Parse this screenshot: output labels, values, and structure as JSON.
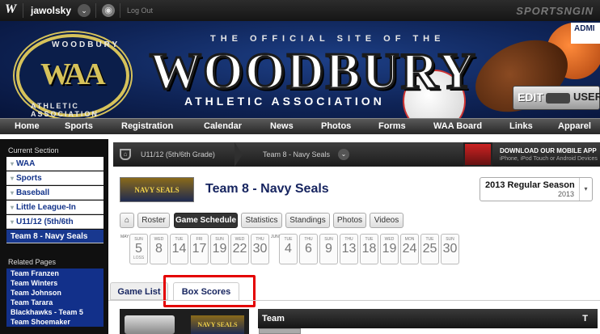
{
  "topbar": {
    "logo_letter": "W",
    "username": "jawolsky",
    "user_menu_icon": "⌄",
    "globe_icon": "◉",
    "logout_label": "Log Out",
    "brand": "SPORTSNGIN"
  },
  "banner": {
    "official": "THE OFFICIAL SITE OF THE",
    "title": "WOODBURY",
    "subtitle": "ATHLETIC ASSOCIATION",
    "logo_text_top": "WOODBURY",
    "logo_mark": "WAA",
    "logo_text_bottom": "ATHLETIC ASSOCIATION",
    "admin_label": "ADMI",
    "edit_label": "EDIT",
    "user_label": "USER"
  },
  "nav": {
    "items": [
      "Home",
      "Sports",
      "Registration",
      "Calendar",
      "News",
      "Photos",
      "Forms",
      "WAA Board",
      "Links",
      "Apparel"
    ],
    "active": "Sports"
  },
  "sidebar": {
    "current_section_label": "Current Section",
    "items": [
      "WAA",
      "Sports",
      "Baseball",
      "Little League-In",
      "U11/12 (5th/6th",
      "Team 8 - Navy Seals"
    ],
    "related_label": "Related Pages",
    "related": [
      "Team Franzen",
      "Team Winters",
      "Team Johnson",
      "Team Tarara",
      "Blackhawks - Team 5",
      "Team Shoemaker"
    ]
  },
  "breadcrumb": {
    "crumb1": "U11/12 (5th/6th Grade)",
    "crumb2": "Team 8 - Navy Seals",
    "app_title": "DOWNLOAD OUR MOBILE APP",
    "app_sub": "iPhone, iPod Touch or Android Devices"
  },
  "team": {
    "logo_text": "NAVY SEALS",
    "name": "Team 8 - Navy Seals",
    "season_name": "2013 Regular Season",
    "season_year": "2013"
  },
  "subtabs": [
    "Roster",
    "Game Schedule",
    "Statistics",
    "Standings",
    "Photos",
    "Videos"
  ],
  "subtab_active": "Game Schedule",
  "schedule": {
    "month1": "MAY",
    "month2": "JUNE",
    "dates": [
      {
        "dow": "SUN",
        "day": "5",
        "result": "LOSS"
      },
      {
        "dow": "WED",
        "day": "8",
        "result": ""
      },
      {
        "dow": "TUE",
        "day": "14",
        "result": ""
      },
      {
        "dow": "FRI",
        "day": "17",
        "result": ""
      },
      {
        "dow": "SUN",
        "day": "19",
        "result": ""
      },
      {
        "dow": "WED",
        "day": "22",
        "result": ""
      },
      {
        "dow": "THU",
        "day": "30",
        "result": ""
      },
      {
        "dow": "TUE",
        "day": "4",
        "result": ""
      },
      {
        "dow": "THU",
        "day": "6",
        "result": ""
      },
      {
        "dow": "SUN",
        "day": "9",
        "result": ""
      },
      {
        "dow": "THU",
        "day": "13",
        "result": ""
      },
      {
        "dow": "TUE",
        "day": "18",
        "result": ""
      },
      {
        "dow": "WED",
        "day": "19",
        "result": ""
      },
      {
        "dow": "MON",
        "day": "24",
        "result": ""
      },
      {
        "dow": "TUE",
        "day": "25",
        "result": ""
      },
      {
        "dow": "SUN",
        "day": "30",
        "result": ""
      }
    ]
  },
  "gametabs": {
    "game_list": "Game List",
    "box_scores": "Box Scores",
    "active": "Box Scores"
  },
  "boxscore": {
    "logo_text": "NAVY SEALS",
    "col_team": "Team",
    "col_t": "T"
  },
  "colors": {
    "accent_blue": "#16245f",
    "highlight_red": "#e40000",
    "sidebar_selected": "#18388f"
  }
}
